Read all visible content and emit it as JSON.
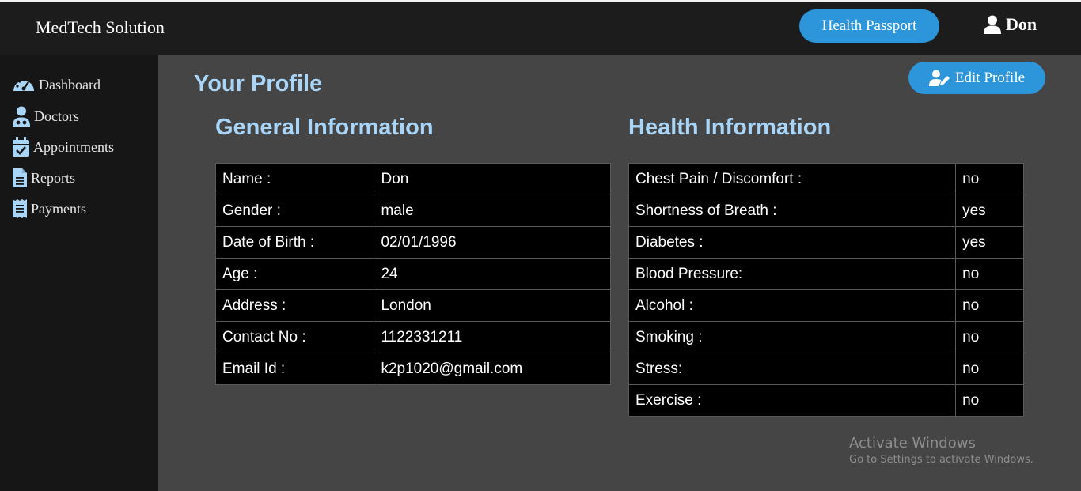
{
  "header": {
    "brand": "MedTech Solution",
    "health_passport_label": "Health Passport",
    "user_name": "Don"
  },
  "sidebar": {
    "items": [
      {
        "label": "Dashboard",
        "icon": "dashboard-icon"
      },
      {
        "label": "Doctors",
        "icon": "doctor-icon"
      },
      {
        "label": "Appointments",
        "icon": "calendar-check-icon"
      },
      {
        "label": "Reports",
        "icon": "file-icon"
      },
      {
        "label": "Payments",
        "icon": "receipt-icon"
      }
    ]
  },
  "main": {
    "title": "Your Profile",
    "edit_label": "Edit Profile",
    "general": {
      "title": "General Information",
      "rows": [
        {
          "label": "Name :",
          "value": "Don"
        },
        {
          "label": "Gender :",
          "value": "male"
        },
        {
          "label": "Date of Birth :",
          "value": "02/01/1996"
        },
        {
          "label": "Age :",
          "value": "24"
        },
        {
          "label": "Address :",
          "value": "London"
        },
        {
          "label": "Contact No :",
          "value": "1122331211"
        },
        {
          "label": "Email Id :",
          "value": "k2p1020@gmail.com"
        }
      ]
    },
    "health": {
      "title": "Health Information",
      "rows": [
        {
          "label": "Chest Pain / Discomfort :",
          "value": "no"
        },
        {
          "label": "Shortness of Breath :",
          "value": "yes"
        },
        {
          "label": "Diabetes :",
          "value": "yes"
        },
        {
          "label": "Blood Pressure:",
          "value": "no"
        },
        {
          "label": "Alcohol :",
          "value": "no"
        },
        {
          "label": "Smoking :",
          "value": "no"
        },
        {
          "label": "Stress:",
          "value": "no"
        },
        {
          "label": "Exercise :",
          "value": "no"
        }
      ]
    }
  },
  "watermark": {
    "line1": "Activate Windows",
    "line2": "Go to Settings to activate Windows."
  },
  "colors": {
    "accent": "#2d96db",
    "heading": "#a9d5f8",
    "topbar": "#1c1c1c",
    "sidebar": "#161616",
    "content": "#454545"
  }
}
